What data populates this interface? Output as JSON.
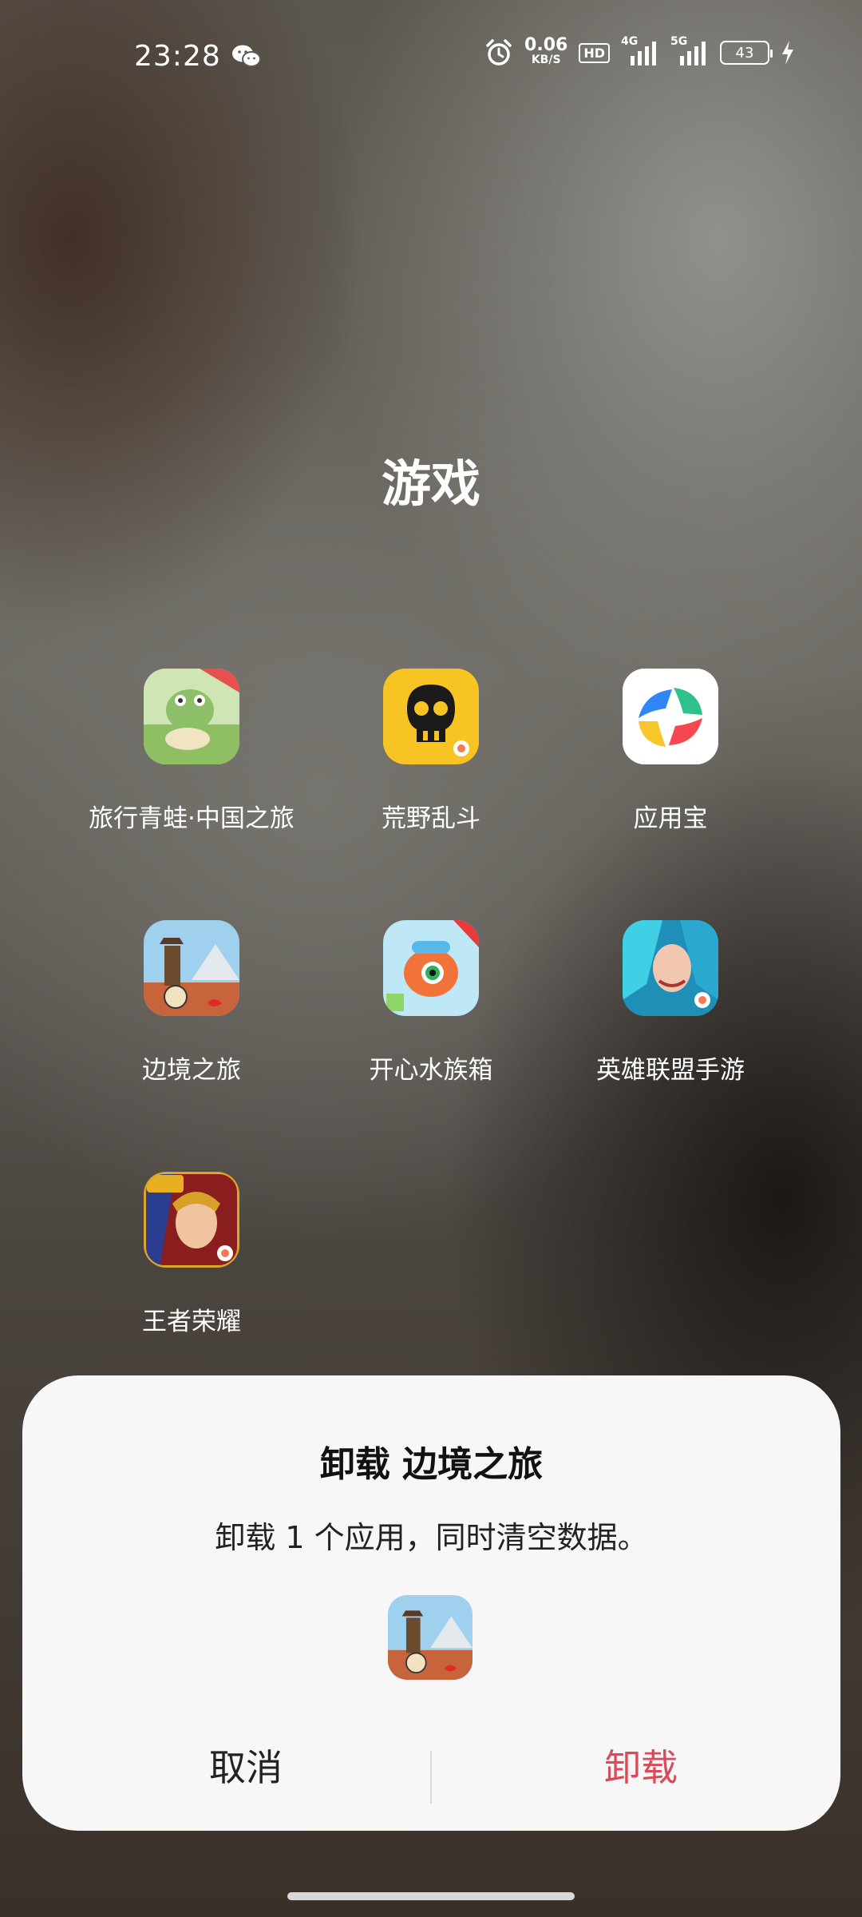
{
  "status_bar": {
    "time": "23:28",
    "net_speed_value": "0.06",
    "net_speed_unit": "KB/S",
    "hd_label": "HD",
    "signal_1_label": "4G",
    "signal_2_label": "5G",
    "battery_level": "43",
    "icons": [
      "wechat-icon",
      "alarm-icon",
      "bolt-icon"
    ]
  },
  "folder": {
    "title": "游戏",
    "apps": [
      {
        "label": "旅行青蛙·中国之旅"
      },
      {
        "label": "荒野乱斗"
      },
      {
        "label": "应用宝"
      },
      {
        "label": "边境之旅"
      },
      {
        "label": "开心水族箱"
      },
      {
        "label": "英雄联盟手游"
      },
      {
        "label": "王者荣耀"
      }
    ]
  },
  "dialog": {
    "title": "卸载 边境之旅",
    "message": "卸载 1 个应用，同时清空数据。",
    "cancel_label": "取消",
    "uninstall_label": "卸载"
  },
  "colors": {
    "accent_uninstall": "#d94a5a",
    "dialog_bg": "#f7f7f7"
  }
}
